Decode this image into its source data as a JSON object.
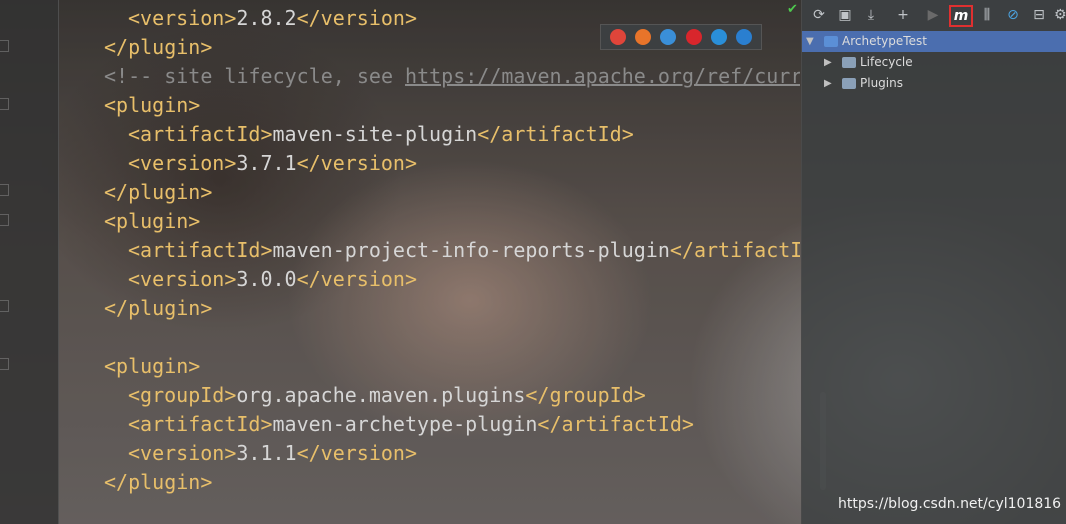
{
  "editor": {
    "lines": [
      {
        "indent": "  ",
        "parts": [
          [
            "tag",
            "<version>"
          ],
          [
            "text",
            "2.8.2"
          ],
          [
            "tag",
            "</version>"
          ]
        ]
      },
      {
        "indent": "",
        "parts": [
          [
            "tag",
            "</plugin>"
          ]
        ]
      },
      {
        "indent": "",
        "parts": [
          [
            "comment",
            "<!-- site lifecycle, see "
          ],
          [
            "link",
            "https://maven.apache.org/ref/curr"
          ]
        ]
      },
      {
        "indent": "",
        "parts": [
          [
            "tag",
            "<plugin>"
          ]
        ]
      },
      {
        "indent": "  ",
        "parts": [
          [
            "tag",
            "<artifactId>"
          ],
          [
            "text",
            "maven-site-plugin"
          ],
          [
            "tag",
            "</artifactId>"
          ]
        ]
      },
      {
        "indent": "  ",
        "parts": [
          [
            "tag",
            "<version>"
          ],
          [
            "text",
            "3.7.1"
          ],
          [
            "tag",
            "</version>"
          ]
        ]
      },
      {
        "indent": "",
        "parts": [
          [
            "tag",
            "</plugin>"
          ]
        ]
      },
      {
        "indent": "",
        "parts": [
          [
            "tag",
            "<plugin>"
          ]
        ]
      },
      {
        "indent": "  ",
        "parts": [
          [
            "tag",
            "<artifactId>"
          ],
          [
            "text",
            "maven-project-info-reports-plugin"
          ],
          [
            "tag",
            "</artifactI"
          ]
        ]
      },
      {
        "indent": "  ",
        "parts": [
          [
            "tag",
            "<version>"
          ],
          [
            "text",
            "3.0.0"
          ],
          [
            "tag",
            "</version>"
          ]
        ]
      },
      {
        "indent": "",
        "parts": [
          [
            "tag",
            "</plugin>"
          ]
        ]
      },
      {
        "indent": "",
        "parts": []
      },
      {
        "indent": "",
        "parts": [
          [
            "tag",
            "<plugin>"
          ]
        ]
      },
      {
        "indent": "  ",
        "parts": [
          [
            "tag",
            "<groupId>"
          ],
          [
            "text",
            "org.apache.maven.plugins"
          ],
          [
            "tag",
            "</groupId>"
          ]
        ]
      },
      {
        "indent": "  ",
        "parts": [
          [
            "tag",
            "<artifactId>"
          ],
          [
            "text",
            "maven-archetype-plugin"
          ],
          [
            "tag",
            "</artifactId>"
          ]
        ]
      },
      {
        "indent": "  ",
        "parts": [
          [
            "tag",
            "<version>"
          ],
          [
            "text",
            "3.1.1"
          ],
          [
            "tag",
            "</version>"
          ]
        ]
      },
      {
        "indent": "",
        "parts": [
          [
            "tag",
            "</plugin>"
          ]
        ]
      }
    ]
  },
  "browser_icons": [
    {
      "name": "chrome-icon",
      "color": "#e0453a"
    },
    {
      "name": "firefox-icon",
      "color": "#e8742a"
    },
    {
      "name": "safari-icon",
      "color": "#3a8fd8"
    },
    {
      "name": "opera-icon",
      "color": "#d8262c"
    },
    {
      "name": "ie-icon",
      "color": "#2a8fd8"
    },
    {
      "name": "edge-icon",
      "color": "#2a7fd0"
    }
  ],
  "toolbar": {
    "reimport": "⟳",
    "generate_sources": "▣",
    "download": "⤓",
    "add": "+",
    "run": "▶",
    "execute_goal": "m",
    "toggle_offline": "⫼",
    "skip_tests": "⊘",
    "show_dependencies": "⊟",
    "settings": "⚙"
  },
  "tree": {
    "root": "ArchetypeTest",
    "children": [
      "Lifecycle",
      "Plugins"
    ]
  },
  "watermark": "https://blog.csdn.net/cyl101816",
  "colors": {
    "selected": "#4b6eaf",
    "tag": "#e8bf6a",
    "highlight_box": "#e03030"
  }
}
